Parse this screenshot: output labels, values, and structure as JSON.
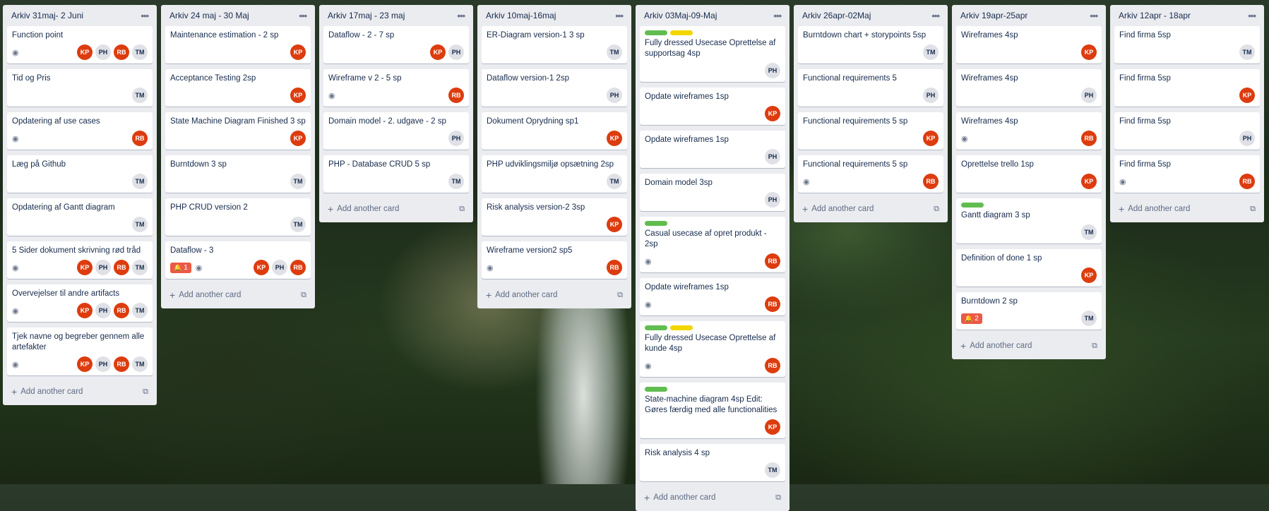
{
  "lists": [
    {
      "title": "Arkiv 31maj- 2 Juni",
      "cards": [
        {
          "title": "Function point",
          "labels": [],
          "watch": true,
          "alert": "",
          "members": [
            "KP",
            "PH",
            "RB",
            "TM"
          ]
        },
        {
          "title": "Tid og Pris",
          "labels": [],
          "watch": false,
          "alert": "",
          "members": [
            "TM"
          ]
        },
        {
          "title": "Opdatering af use cases",
          "labels": [],
          "watch": true,
          "alert": "",
          "members": [
            "RB"
          ]
        },
        {
          "title": "Læg på Github",
          "labels": [],
          "watch": false,
          "alert": "",
          "members": [
            "TM"
          ]
        },
        {
          "title": "Opdatering af Gantt diagram",
          "labels": [],
          "watch": false,
          "alert": "",
          "members": [
            "TM"
          ]
        },
        {
          "title": "5 Sider dokument skrivning rød tråd",
          "labels": [],
          "watch": true,
          "alert": "",
          "members": [
            "KP",
            "PH",
            "RB",
            "TM"
          ]
        },
        {
          "title": "Overvejelser til andre artifacts",
          "labels": [],
          "watch": true,
          "alert": "",
          "members": [
            "KP",
            "PH",
            "RB",
            "TM"
          ]
        },
        {
          "title": "Tjek navne og begreber gennem alle artefakter",
          "labels": [],
          "watch": true,
          "alert": "",
          "members": [
            "KP",
            "PH",
            "RB",
            "TM"
          ]
        }
      ]
    },
    {
      "title": "Arkiv 24 maj - 30 Maj",
      "cards": [
        {
          "title": "Maintenance estimation - 2 sp",
          "labels": [],
          "watch": false,
          "alert": "",
          "members": [
            "KP"
          ]
        },
        {
          "title": "Acceptance Testing 2sp",
          "labels": [],
          "watch": false,
          "alert": "",
          "members": [
            "KP"
          ]
        },
        {
          "title": "State Machine Diagram Finished 3 sp",
          "labels": [],
          "watch": false,
          "alert": "",
          "members": [
            "KP"
          ]
        },
        {
          "title": "Burntdown 3 sp",
          "labels": [],
          "watch": false,
          "alert": "",
          "members": [
            "TM"
          ]
        },
        {
          "title": "PHP CRUD version 2",
          "labels": [],
          "watch": false,
          "alert": "",
          "members": [
            "TM"
          ]
        },
        {
          "title": "Dataflow - 3",
          "labels": [],
          "watch": true,
          "alert": "1",
          "members": [
            "KP",
            "PH",
            "RB"
          ]
        }
      ]
    },
    {
      "title": "Arkiv 17maj - 23 maj",
      "cards": [
        {
          "title": "Dataflow - 2 - 7 sp",
          "labels": [],
          "watch": false,
          "alert": "",
          "members": [
            "KP",
            "PH"
          ]
        },
        {
          "title": "Wireframe v 2 - 5 sp",
          "labels": [],
          "watch": true,
          "alert": "",
          "members": [
            "RB"
          ]
        },
        {
          "title": "Domain model - 2. udgave - 2 sp",
          "labels": [],
          "watch": false,
          "alert": "",
          "members": [
            "PH"
          ]
        },
        {
          "title": "PHP - Database CRUD 5 sp",
          "labels": [],
          "watch": false,
          "alert": "",
          "members": [
            "TM"
          ]
        }
      ]
    },
    {
      "title": "Arkiv 10maj-16maj",
      "cards": [
        {
          "title": "ER-Diagram version-1 3 sp",
          "labels": [],
          "watch": false,
          "alert": "",
          "members": [
            "TM"
          ]
        },
        {
          "title": "Dataflow version-1 2sp",
          "labels": [],
          "watch": false,
          "alert": "",
          "members": [
            "PH"
          ]
        },
        {
          "title": "Dokument Oprydning sp1",
          "labels": [],
          "watch": false,
          "alert": "",
          "members": [
            "KP"
          ]
        },
        {
          "title": "PHP udviklingsmiljø opsætning 2sp",
          "labels": [],
          "watch": false,
          "alert": "",
          "members": [
            "TM"
          ]
        },
        {
          "title": "Risk analysis version-2 3sp",
          "labels": [],
          "watch": false,
          "alert": "",
          "members": [
            "KP"
          ]
        },
        {
          "title": "Wireframe version2 sp5",
          "labels": [],
          "watch": true,
          "alert": "",
          "members": [
            "RB"
          ]
        }
      ]
    },
    {
      "title": "Arkiv 03Maj-09-Maj",
      "cards": [
        {
          "title": "Fully dressed Usecase Oprettelse af supportsag 4sp",
          "labels": [
            "#61bd4f",
            "#f2d600"
          ],
          "watch": false,
          "alert": "",
          "members": [
            "PH"
          ]
        },
        {
          "title": "Opdate wireframes 1sp",
          "labels": [],
          "watch": false,
          "alert": "",
          "members": [
            "KP"
          ]
        },
        {
          "title": "Opdate wireframes 1sp",
          "labels": [],
          "watch": false,
          "alert": "",
          "members": [
            "PH"
          ]
        },
        {
          "title": "Domain model 3sp",
          "labels": [],
          "watch": false,
          "alert": "",
          "members": [
            "PH"
          ]
        },
        {
          "title": "Casual usecase af opret produkt - 2sp",
          "labels": [
            "#61bd4f"
          ],
          "watch": true,
          "alert": "",
          "members": [
            "RB"
          ]
        },
        {
          "title": "Opdate wireframes 1sp",
          "labels": [],
          "watch": true,
          "alert": "",
          "members": [
            "RB"
          ]
        },
        {
          "title": "Fully dressed Usecase Oprettelse af kunde 4sp",
          "labels": [
            "#61bd4f",
            "#f2d600"
          ],
          "watch": true,
          "alert": "",
          "members": [
            "RB"
          ]
        },
        {
          "title": "State-machine diagram 4sp Edit: Gøres færdig med alle functionalities",
          "labels": [
            "#61bd4f"
          ],
          "watch": false,
          "alert": "",
          "members": [
            "KP"
          ]
        },
        {
          "title": "Risk analysis 4 sp",
          "labels": [],
          "watch": false,
          "alert": "",
          "members": [
            "TM"
          ]
        }
      ]
    },
    {
      "title": "Arkiv 26apr-02Maj",
      "cards": [
        {
          "title": "Burntdown chart + storypoints 5sp",
          "labels": [],
          "watch": false,
          "alert": "",
          "members": [
            "TM"
          ]
        },
        {
          "title": "Functional requirements 5",
          "labels": [],
          "watch": false,
          "alert": "",
          "members": [
            "PH"
          ]
        },
        {
          "title": "Functional requirements 5 sp",
          "labels": [],
          "watch": false,
          "alert": "",
          "members": [
            "KP"
          ]
        },
        {
          "title": "Functional requirements 5 sp",
          "labels": [],
          "watch": true,
          "alert": "",
          "members": [
            "RB"
          ]
        }
      ]
    },
    {
      "title": "Arkiv 19apr-25apr",
      "cards": [
        {
          "title": "Wireframes 4sp",
          "labels": [],
          "watch": false,
          "alert": "",
          "members": [
            "KP"
          ]
        },
        {
          "title": "Wireframes 4sp",
          "labels": [],
          "watch": false,
          "alert": "",
          "members": [
            "PH"
          ]
        },
        {
          "title": "Wireframes 4sp",
          "labels": [],
          "watch": true,
          "alert": "",
          "members": [
            "RB"
          ]
        },
        {
          "title": "Oprettelse trello 1sp",
          "labels": [],
          "watch": false,
          "alert": "",
          "members": [
            "KP"
          ]
        },
        {
          "title": "Gantt diagram 3 sp",
          "labels": [
            "#61bd4f"
          ],
          "watch": false,
          "alert": "",
          "members": [
            "TM"
          ]
        },
        {
          "title": "Definition of done 1 sp",
          "labels": [],
          "watch": false,
          "alert": "",
          "members": [
            "KP"
          ]
        },
        {
          "title": "Burntdown 2 sp",
          "labels": [],
          "watch": false,
          "alert": "2",
          "members": [
            "TM"
          ]
        }
      ]
    },
    {
      "title": "Arkiv 12apr - 18apr",
      "cards": [
        {
          "title": "Find firma 5sp",
          "labels": [],
          "watch": false,
          "alert": "",
          "members": [
            "TM"
          ]
        },
        {
          "title": "Find firma 5sp",
          "labels": [],
          "watch": false,
          "alert": "",
          "members": [
            "KP"
          ]
        },
        {
          "title": "Find firma 5sp",
          "labels": [],
          "watch": false,
          "alert": "",
          "members": [
            "PH"
          ]
        },
        {
          "title": "Find firma 5sp",
          "labels": [],
          "watch": true,
          "alert": "",
          "members": [
            "RB"
          ]
        }
      ]
    }
  ],
  "add_card_label": "Add another card",
  "icons": {
    "list_menu": "more-horizontal-icon",
    "watch": "eye-icon",
    "alert": "bell-icon",
    "add": "plus-icon",
    "template": "card-template-icon"
  },
  "colors": {
    "member_orange": "#dd3c0f",
    "member_gray": "#dfe1e6",
    "alert_red": "#eb5a46",
    "label_green": "#61bd4f",
    "label_yellow": "#f2d600",
    "list_bg": "#ebecf0"
  }
}
